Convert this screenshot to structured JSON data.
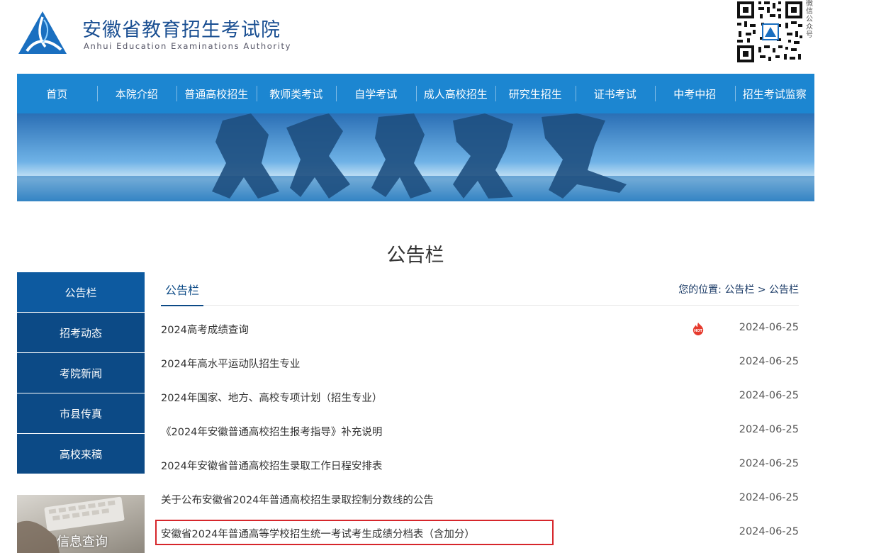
{
  "header": {
    "title": "安徽省教育招生考试院",
    "subtitle": "Anhui Education Examinations Authority",
    "qr_label": "微信公众号"
  },
  "nav": {
    "items": [
      "首页",
      "本院介绍",
      "普通高校招生",
      "教师类考试",
      "自学考试",
      "成人高校招生",
      "研究生招生",
      "证书考试",
      "中考中招",
      "招生考试监察"
    ]
  },
  "page": {
    "heading": "公告栏"
  },
  "sidebar": {
    "items": [
      "公告栏",
      "招考动态",
      "考院新闻",
      "市县传真",
      "高校来稿"
    ],
    "info_label": "信息查询"
  },
  "main": {
    "tab": "公告栏",
    "breadcrumb": {
      "prefix": "您的位置:",
      "level1": "公告栏",
      "sep": ">",
      "level2": "公告栏"
    },
    "rows": [
      {
        "title": "2024高考成绩查询",
        "date": "2024-06-25",
        "hot": true
      },
      {
        "title": "2024年高水平运动队招生专业",
        "date": "2024-06-25"
      },
      {
        "title": "2024年国家、地方、高校专项计划（招生专业）",
        "date": "2024-06-25"
      },
      {
        "title": "《2024年安徽普通高校招生报考指导》补充说明",
        "date": "2024-06-25"
      },
      {
        "title": "2024年安徽省普通高校招生录取工作日程安排表",
        "date": "2024-06-25"
      },
      {
        "title": "关于公布安徽省2024年普通高校招生录取控制分数线的公告",
        "date": "2024-06-25"
      },
      {
        "title": "安徽省2024年普通高等学校招生统一考试考生成绩分档表（含加分）",
        "date": "2024-06-25"
      }
    ]
  },
  "colors": {
    "nav_bg": "#1c86d1",
    "sidebar_bg": "#0c4a86",
    "highlight": "#d6262b"
  },
  "icons": {
    "logo": "logo-icon",
    "hot": "hot-icon",
    "qr": "qr-code-icon"
  }
}
